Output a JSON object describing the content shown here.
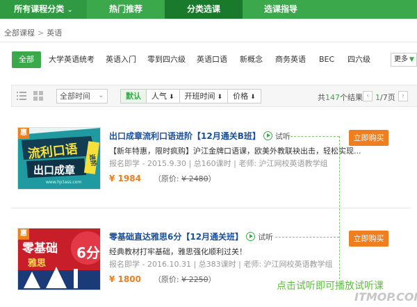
{
  "topnav": {
    "all_courses": "所有课程分类",
    "hot": "热门推荐",
    "category": "分类选课",
    "guide": "选课指导"
  },
  "breadcrumb": {
    "root": "全部课程",
    "sep": ">",
    "current": "英语"
  },
  "filter": {
    "tags": [
      "全部",
      "大学英语统考",
      "英语入门",
      "零到四六级",
      "英语口语",
      "新概念",
      "商务英语",
      "BEC",
      "四六级"
    ],
    "more": "更多"
  },
  "sortbar": {
    "time_select": "全部时间",
    "tabs": [
      "默认",
      "人气",
      "开班时间",
      "价格"
    ],
    "result_prefix": "共",
    "result_count": "147",
    "result_suffix": "个结果",
    "page_current": "1",
    "page_total": "/7页"
  },
  "courses": [
    {
      "badge": "惠",
      "thumb_line1": "流利口语",
      "thumb_line2": "出口成章",
      "thumb_side": "进阶",
      "thumb_url": "www.hjclass.com",
      "title": "出口成章流利口语进阶【12月通关B班】",
      "try_label": "试听",
      "desc": "【新年特惠，限时疯购】沪江金牌口语课，欧美外教联袂出击，轻松实现...",
      "meta": "报名即学 - 2015.9.30 | 总160课时 | 老师: 沪江网校英语教学组",
      "price_now": "¥ 1984",
      "price_orig_label": "（原价: ",
      "price_orig": "¥ 2480",
      "price_orig_close": "）",
      "buy": "立即购买"
    },
    {
      "badge": "惠",
      "thumb_line1": "零基础",
      "thumb_line2": "雅思",
      "thumb_side": "6分",
      "title": "零基础直达雅思6分【12月通关班】",
      "try_label": "试听",
      "desc": "经典教材打牢基础，雅思强化顺利过关！",
      "meta": "报名即学 - 2016.10.31 | 总383课时 | 老师: 沪江网校英语教学组",
      "price_now": "¥ 1800",
      "price_orig_label": "（原价: ",
      "price_orig": "¥ 2250",
      "price_orig_close": "）",
      "buy": "立即购买"
    }
  ],
  "annotation": "点击试听即可播放试听课",
  "watermark": "ITMOP.COM",
  "colors": {
    "brand_green": "#3aa84b",
    "accent_orange": "#f07d1e",
    "link_blue": "#1a4f9c"
  }
}
